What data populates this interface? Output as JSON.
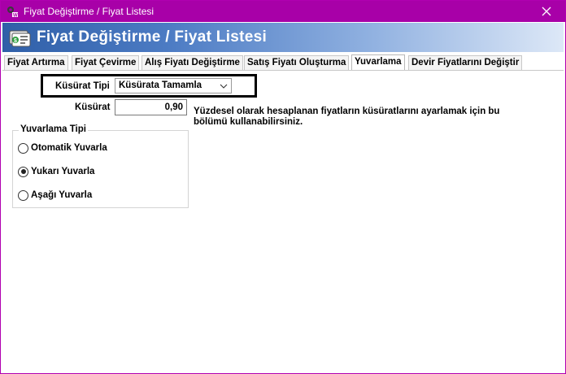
{
  "window": {
    "title": "Fiyat Değiştirme / Fiyat Listesi",
    "close_glyph": "✕"
  },
  "banner": {
    "title": "Fiyat Değiştirme / Fiyat Listesi",
    "icon": "price-tags-icon"
  },
  "tabs": [
    {
      "label": "Fiyat Artırma",
      "active": false
    },
    {
      "label": "Fiyat Çevirme",
      "active": false
    },
    {
      "label": "Alış Fiyatı Değiştirme",
      "active": false
    },
    {
      "label": "Satış Fiyatı Oluşturma",
      "active": false
    },
    {
      "label": "Yuvarlama",
      "active": true
    },
    {
      "label": "Devir Fiyatlarını Değiştir",
      "active": false
    }
  ],
  "form": {
    "kusurat_tipi_label": "Küsürat Tipi",
    "kusurat_tipi_value": "Küsürata Tamamla",
    "kusurat_label": "Küsürat",
    "kusurat_value": "0,90",
    "info_text": "Yüzdesel olarak hesaplanan fiyatların küsüratlarını ayarlamak için bu bölümü kullanabilirsiniz."
  },
  "rounding_group": {
    "legend": "Yuvarlama Tipi",
    "options": [
      {
        "label": "Otomatik Yuvarla",
        "checked": false
      },
      {
        "label": "Yukarı Yuvarla",
        "checked": true
      },
      {
        "label": "Aşağı Yuvarla",
        "checked": false
      }
    ]
  },
  "colors": {
    "titlebar": "#a800a8",
    "banner_start": "#2f5fa8",
    "banner_end": "#dde8f7"
  }
}
